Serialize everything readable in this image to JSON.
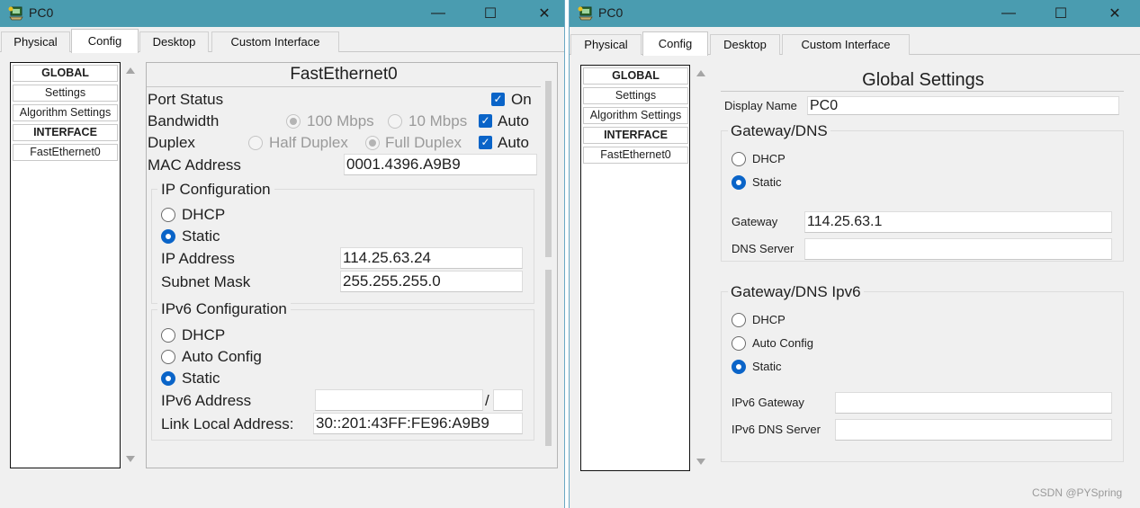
{
  "left_window": {
    "title": "PC0",
    "tabs": [
      "Physical",
      "Config",
      "Desktop",
      "Custom Interface"
    ],
    "active_tab": "Config",
    "sidebar": [
      "GLOBAL",
      "Settings",
      "Algorithm Settings",
      "INTERFACE",
      "FastEthernet0"
    ],
    "panel": {
      "title": "FastEthernet0",
      "port_status_label": "Port Status",
      "port_status_on_label": "On",
      "port_status_on": true,
      "bandwidth_label": "Bandwidth",
      "bandwidth_options": [
        "100 Mbps",
        "10 Mbps"
      ],
      "bandwidth_auto_label": "Auto",
      "bandwidth_auto": true,
      "duplex_label": "Duplex",
      "duplex_options": [
        "Half Duplex",
        "Full Duplex"
      ],
      "duplex_auto_label": "Auto",
      "duplex_auto": true,
      "mac_label": "MAC Address",
      "mac_value": "0001.4396.A9B9",
      "ip_config": {
        "title": "IP Configuration",
        "dhcp_label": "DHCP",
        "static_label": "Static",
        "selected": "Static",
        "ip_label": "IP Address",
        "ip_value": "114.25.63.24",
        "mask_label": "Subnet Mask",
        "mask_value": "255.255.255.0"
      },
      "ipv6_config": {
        "title": "IPv6 Configuration",
        "dhcp_label": "DHCP",
        "auto_label": "Auto Config",
        "static_label": "Static",
        "selected": "Static",
        "ipv6_label": "IPv6 Address",
        "ipv6_value": "",
        "prefix_sep": "/",
        "prefix_value": "",
        "link_local_label": "Link Local Address:",
        "link_local_value": "30::201:43FF:FE96:A9B9"
      }
    }
  },
  "right_window": {
    "title": "PC0",
    "tabs": [
      "Physical",
      "Config",
      "Desktop",
      "Custom Interface"
    ],
    "active_tab": "Config",
    "sidebar": [
      "GLOBAL",
      "Settings",
      "Algorithm Settings",
      "INTERFACE",
      "FastEthernet0"
    ],
    "panel": {
      "title": "Global Settings",
      "display_name_label": "Display Name",
      "display_name_value": "PC0",
      "gateway_dns": {
        "title": "Gateway/DNS",
        "dhcp_label": "DHCP",
        "static_label": "Static",
        "selected": "Static",
        "gateway_label": "Gateway",
        "gateway_value": "114.25.63.1",
        "dns_label": "DNS Server",
        "dns_value": ""
      },
      "gateway_dns_ipv6": {
        "title": "Gateway/DNS Ipv6",
        "dhcp_label": "DHCP",
        "auto_label": "Auto Config",
        "static_label": "Static",
        "selected": "Static",
        "gateway_label": "IPv6 Gateway",
        "gateway_value": "",
        "dns_label": "IPv6 DNS Server",
        "dns_value": ""
      }
    }
  },
  "window_buttons": {
    "minimize": "—",
    "maximize": "☐",
    "close": "✕"
  },
  "watermark": "CSDN @PYSpring",
  "colors": {
    "titlebar": "#4a9cb0",
    "accent": "#0a64c8"
  }
}
